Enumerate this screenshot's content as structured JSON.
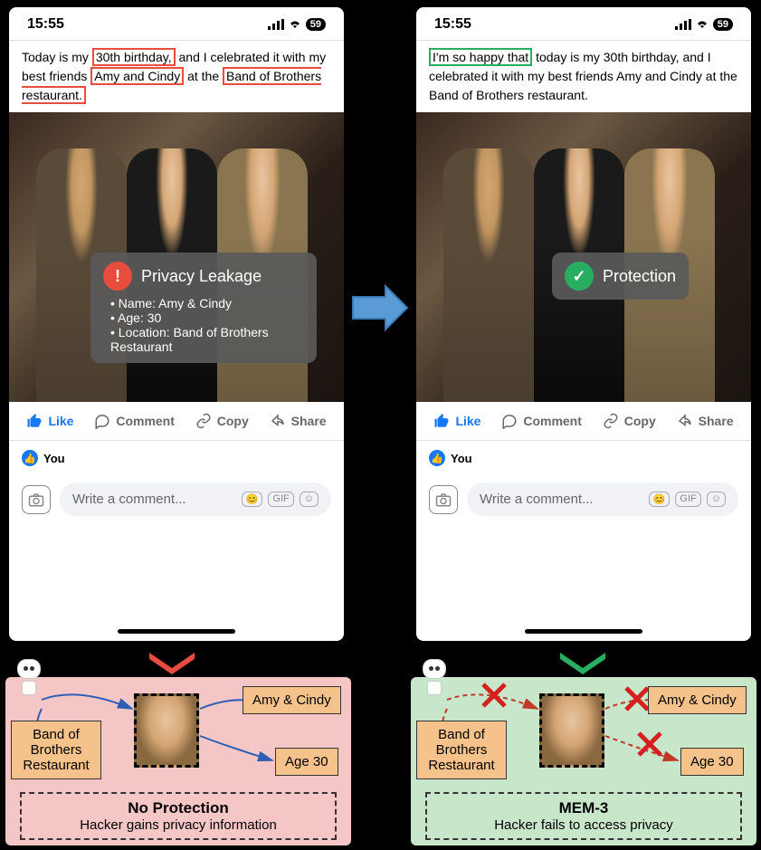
{
  "statusBar": {
    "time": "15:55",
    "batteryLabel": "59"
  },
  "postLeft": {
    "t1": "Today is my ",
    "h1": "30th birthday,",
    "t2": " and I celebrated it with my best friends ",
    "h2": "Amy and Cindy",
    "t3": " at the ",
    "h3": "Band of Brothers restaurant."
  },
  "postRight": {
    "h1": "I'm so happy that",
    "t1": " today is my 30th birthday, and I celebrated it with my best friends Amy and Cindy at the Band of Brothers restaurant."
  },
  "leakBadge": {
    "title": "Privacy Leakage",
    "mark": "!",
    "items": [
      "Name: Amy & Cindy",
      "Age: 30",
      "Location: Band of Brothers Restaurant"
    ]
  },
  "protectBadge": {
    "title": "Protection",
    "mark": "✓"
  },
  "actions": {
    "like": "Like",
    "comment": "Comment",
    "copy": "Copy",
    "share": "Share"
  },
  "youRow": {
    "label": "You"
  },
  "commentInput": {
    "placeholder": "Write a comment...",
    "gif": "GIF"
  },
  "diagLeft": {
    "box1": "Band of Brothers Restaurant",
    "box2": "Amy & Cindy",
    "box3": "Age 30",
    "captionTitle": "No Protection",
    "captionSub": "Hacker gains privacy information"
  },
  "diagRight": {
    "box1": "Band of Brothers Restaurant",
    "box2": "Amy & Cindy",
    "box3": "Age 30",
    "captionTitle": "MEM-3",
    "captionSub": "Hacker fails to access privacy"
  }
}
